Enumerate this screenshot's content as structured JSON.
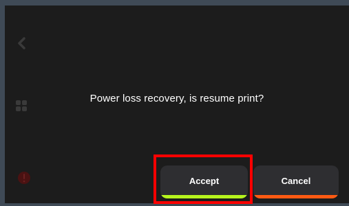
{
  "dialog": {
    "message": "Power loss recovery, is resume print?"
  },
  "buttons": {
    "accept": {
      "label": "Accept",
      "accent_color": "#b6f41d"
    },
    "cancel": {
      "label": "Cancel",
      "accent_color": "#ff5a12"
    }
  },
  "sidebar": {
    "icons": [
      "back-icon",
      "grid-icon",
      "alert-icon"
    ]
  },
  "colors": {
    "screen_background": "#1c1c1c",
    "button_background": "#2e2e31",
    "highlight": "#ff0000"
  }
}
